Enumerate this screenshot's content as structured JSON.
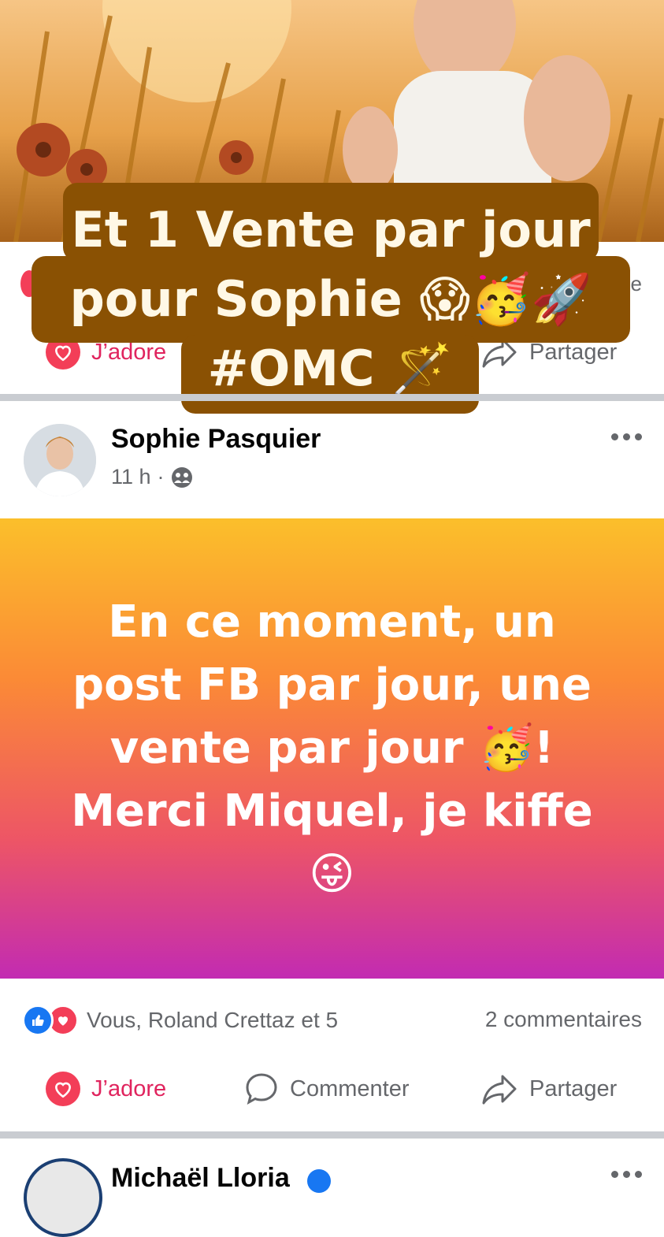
{
  "previous_post": {
    "actions": {
      "love_label": "J’adore",
      "share_label": "Partager"
    },
    "caption_lines": [
      "Et 1 Vente par jour",
      "pour Sophie 😱🥳🚀",
      "#OMC 🪄"
    ]
  },
  "post": {
    "author": "Sophie Pasquier",
    "time": "11 h",
    "privacy_icon": "friends-icon",
    "text_lines": [
      "En ce moment, un",
      "post FB par jour, une",
      "vente par jour 🥳!",
      "Merci Miquel, je kiffe",
      "😜"
    ],
    "background_gradient": [
      "#fbbf2b",
      "#fb8a36",
      "#ed5566",
      "#c22bb2"
    ],
    "reactions_text": "Vous, Roland Crettaz et 5",
    "comments_text": "2 commentaires",
    "actions": {
      "love_label": "J’adore",
      "comment_label": "Commenter",
      "share_label": "Partager"
    }
  },
  "next_post": {
    "author": "Michaël Lloria"
  },
  "colors": {
    "love": "#e0245e",
    "like": "#1877f2",
    "caption_bg": "#8a5103"
  }
}
